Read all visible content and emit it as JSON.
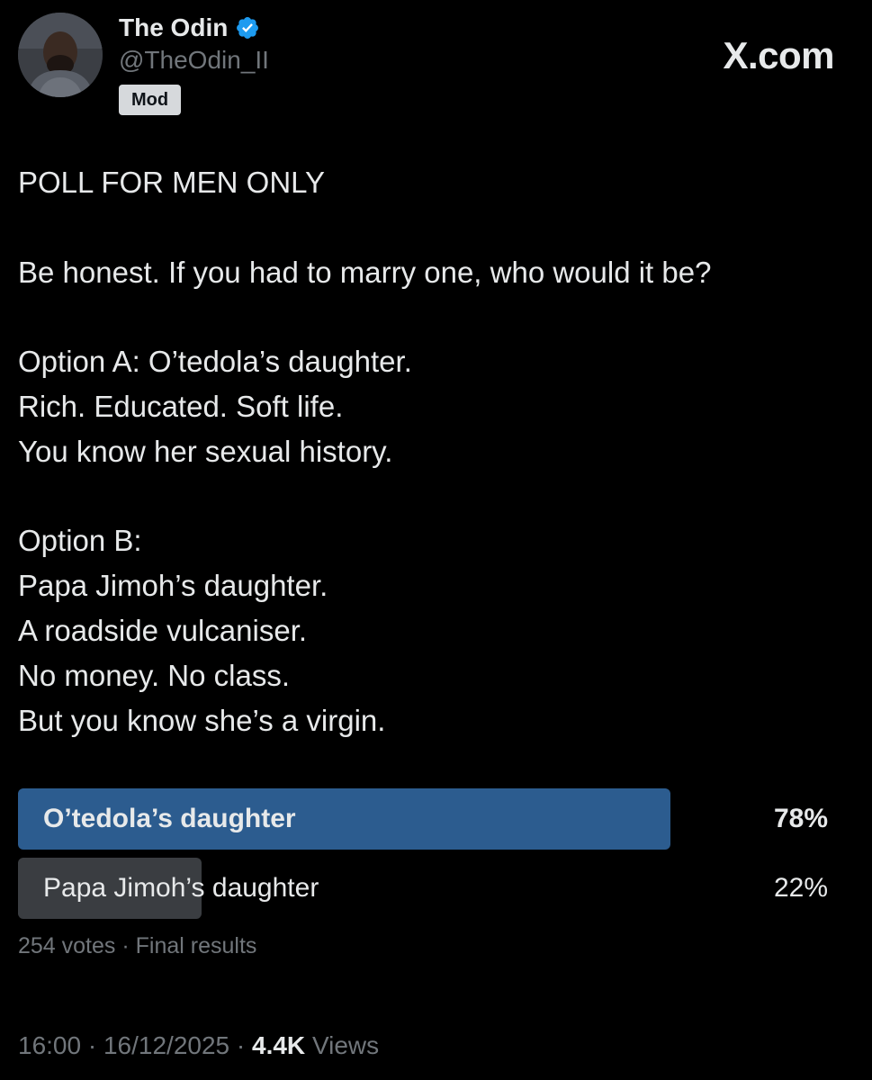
{
  "author": {
    "display_name": "The Odin",
    "handle": "@TheOdin_II",
    "badge": "Mod",
    "avatar_icon": "profile-photo",
    "verified_icon": "verified-badge-icon",
    "verified_color": "#1d9bf0"
  },
  "brand": "X.com",
  "tweet": {
    "lines": [
      "POLL FOR MEN ONLY",
      "",
      "Be honest. If you had to marry one, who would it be?",
      "",
      "Option A: O’tedola’s daughter.",
      "Rich. Educated. Soft life.",
      "You know her sexual history.",
      "",
      "Option B:",
      "Papa Jimoh’s daughter.",
      "A roadside vulcaniser.",
      "No money. No class.",
      "But you know she’s a virgin."
    ]
  },
  "poll": {
    "options": [
      {
        "label": "O’tedola’s daughter",
        "percent_text": "78%",
        "share": 0.78,
        "fill_color": "#2c5c8f",
        "winner": true
      },
      {
        "label": "Papa Jimoh’s daughter",
        "percent_text": "22%",
        "share": 0.22,
        "fill_color": "#3a3d41",
        "winner": false
      }
    ],
    "votes": "254 votes",
    "separator": "·",
    "status": "Final results"
  },
  "meta": {
    "time": "16:00",
    "date": "16/12/2025",
    "views_count": "4.4K",
    "views_label": "Views",
    "separator": "·"
  },
  "colors": {
    "background": "#000000",
    "text_primary": "#e7e9ea",
    "text_secondary": "#71767b"
  }
}
